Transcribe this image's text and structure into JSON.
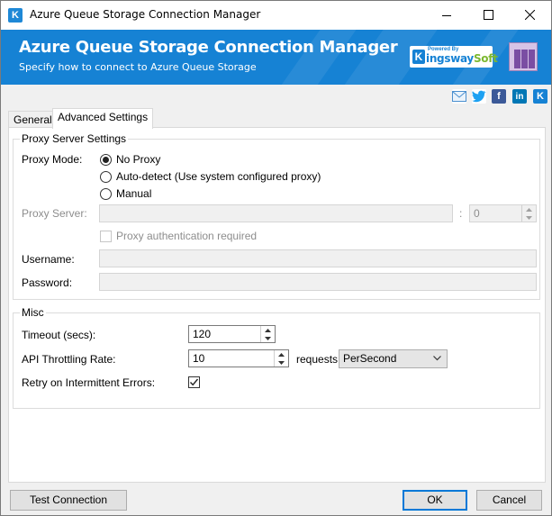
{
  "window": {
    "title": "Azure Queue Storage Connection Manager"
  },
  "banner": {
    "title": "Azure Queue Storage Connection Manager",
    "subtitle": "Specify how to connect to Azure Queue Storage",
    "logo_powered": "Powered By",
    "logo_name_main": "ingsway",
    "logo_name_accent": "Soft",
    "logo_k": "K"
  },
  "social": [
    "email-icon",
    "twitter-icon",
    "facebook-icon",
    "linkedin-icon",
    "kingswaysoft-icon"
  ],
  "tabs": [
    {
      "label": "General"
    },
    {
      "label": "Advanced Settings"
    }
  ],
  "proxy": {
    "group_title": "Proxy Server Settings",
    "mode_label": "Proxy Mode:",
    "options": [
      "No Proxy",
      "Auto-detect (Use system configured proxy)",
      "Manual"
    ],
    "selected": "No Proxy",
    "server_label": "Proxy Server:",
    "server_value": "",
    "port_separator": ":",
    "port_value": "0",
    "auth_label": "Proxy authentication required",
    "username_label": "Username:",
    "username_value": "",
    "password_label": "Password:",
    "password_value": ""
  },
  "misc": {
    "group_title": "Misc",
    "timeout_label": "Timeout (secs):",
    "timeout_value": "120",
    "throttle_label": "API Throttling Rate:",
    "throttle_value": "10",
    "requests_label": "requests",
    "rate_unit": "PerSecond",
    "retry_label": "Retry on Intermittent Errors:",
    "retry_checked": true
  },
  "buttons": {
    "test": "Test Connection",
    "ok": "OK",
    "cancel": "Cancel"
  },
  "colors": {
    "banner": "#1682d4",
    "accent_green": "#7cb82f",
    "default_button_border": "#0078d7"
  }
}
